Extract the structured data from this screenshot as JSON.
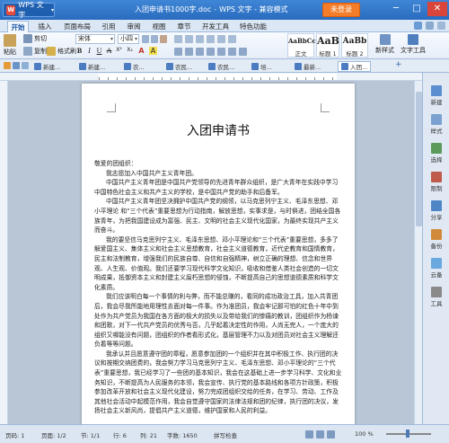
{
  "titlebar": {
    "app_name": "WPS 文字",
    "doc_title": "入团申请书1000字.doc",
    "separator": "-",
    "app_label": "WPS 文字 - 兼容模式",
    "login_button": "未登录",
    "win_min": "─",
    "win_max": "□",
    "win_close": "✕"
  },
  "menu": {
    "tabs": [
      "开始",
      "插入",
      "页面布局",
      "引用",
      "审阅",
      "视图",
      "章节",
      "开发工具",
      "特色功能"
    ],
    "active": "开始"
  },
  "ribbon": {
    "paste": "粘贴",
    "cut": "剪切",
    "copy": "复制",
    "format_painter": "格式刷",
    "font_name": "宋体",
    "font_size": "小四",
    "styles": [
      {
        "sample": "AaBbCcD",
        "label": "正文"
      },
      {
        "sample": "AaB",
        "label": "标题 1"
      },
      {
        "sample": "AaBb",
        "label": "标题 2"
      }
    ],
    "new_style": "新样式",
    "text_tools": "文字工具"
  },
  "doc_tabs": [
    {
      "label": "新建..."
    },
    {
      "label": "新建..."
    },
    {
      "label": "农..."
    },
    {
      "label": "农民..."
    },
    {
      "label": "农民..."
    },
    {
      "label": "培..."
    },
    {
      "label": "最新..."
    },
    {
      "label": "入团..."
    }
  ],
  "document": {
    "heading": "入团申请书",
    "paragraphs": [
      {
        "indent": false,
        "text": "敬爱的团组织："
      },
      {
        "indent": true,
        "text": "我志愿加入中国共产主义青年团。"
      },
      {
        "indent": true,
        "text": "中国共产主义青年团是中国共产党领导的先进青年群众组织，是广大青年在实践中学习中国特色社会主义和共产主义的学校，是中国共产党的助手和后备军。"
      },
      {
        "indent": true,
        "text": "中国共产主义青年团坚决拥护中国共产党的纲领，以马克思列宁主义、毛泽东思想、邓小平理论 和“三个代表”重要思想为行动指南，解放思想，实事求是，与时俱进，团结全国各族青年，为把我国建设成为富强、民主、文明的社会主义现代化国家，为最终实现共产主义而奋斗。"
      },
      {
        "indent": true,
        "text": "我的要坚信马克思列宁主义、毛泽东思想、邓小平理论和“三个代表”重要思想，多多了解爱国主义、集体主义和社会主义思想教育，社会主义道德教育，近代史教育和国情教育，民主和法制教育，增强我们的民族自尊、自信和自强精神，树立正确的理想、信念和世界观、人生观、价值观。我们还要学习现代科学文化知识，吸收和借鉴人类社会创造的一切文明成果，抵御资本主义和封建主义腐朽思想的侵蚀，不断提高自己的思想道德素质和科学文化素质。"
      },
      {
        "indent": true,
        "text": "我们应该明白每一个事情的利与弊，而不能总赚的，看同的成功政治工具，加入共青团后，我会尽我所能地用理性去面对每一件事。作为准团员，我会牢记那可怕的红色十年中到处作为共产党员为我国在各方面的极大的损失以及带给我们的惨痛的教训，团组织作为杨谏和团歌，对下一代共产党员的优秀与否，几乎起着决定性的作用，人尚无完人，一个庞大的组织又哪能没有问题，团组织的作者看形式化，基层管理不力以及对团员对社会主义理解还负着等等问题。"
      },
      {
        "indent": true,
        "text": "我承认并且愿意遵守团的章程，愿意参加团的一个组织并在其中积极工作、执行团的决议和按期交纳团费的，我会努力学习马克思列宁主义、毛泽东思想、邓小平理论的“三个代表”重要思想，我已经学习了一些团的基本知识，我会在这基础上进一步学习科学、文化和业务知识，不断提高为人民服务的本领，我会宣传、执行党的基本路线和各项方针政策，积极参加改革开放和社会主义现代化建设，努力完成团组织交给的任务，在学习、劳动、工作及其他社会活动中起模范作用，我会自觉遵守国家的法律法规和团的纪律，执行团的决议，发扬社会主义新风尚，提倡共产主义道德，维护国家和人民的利益。"
      }
    ]
  },
  "sidepanel": {
    "items": [
      "新建",
      "样式",
      "选择",
      "限制",
      "分享",
      "备份",
      "云备",
      "工具"
    ]
  },
  "status": {
    "page": "页码: 1",
    "pages": "页面: 1/2",
    "section": "节: 1/1",
    "row": "行: 6",
    "col": "列: 21",
    "words": "字数: 1650",
    "spell": "拼写检查",
    "zoom": "100 %"
  }
}
